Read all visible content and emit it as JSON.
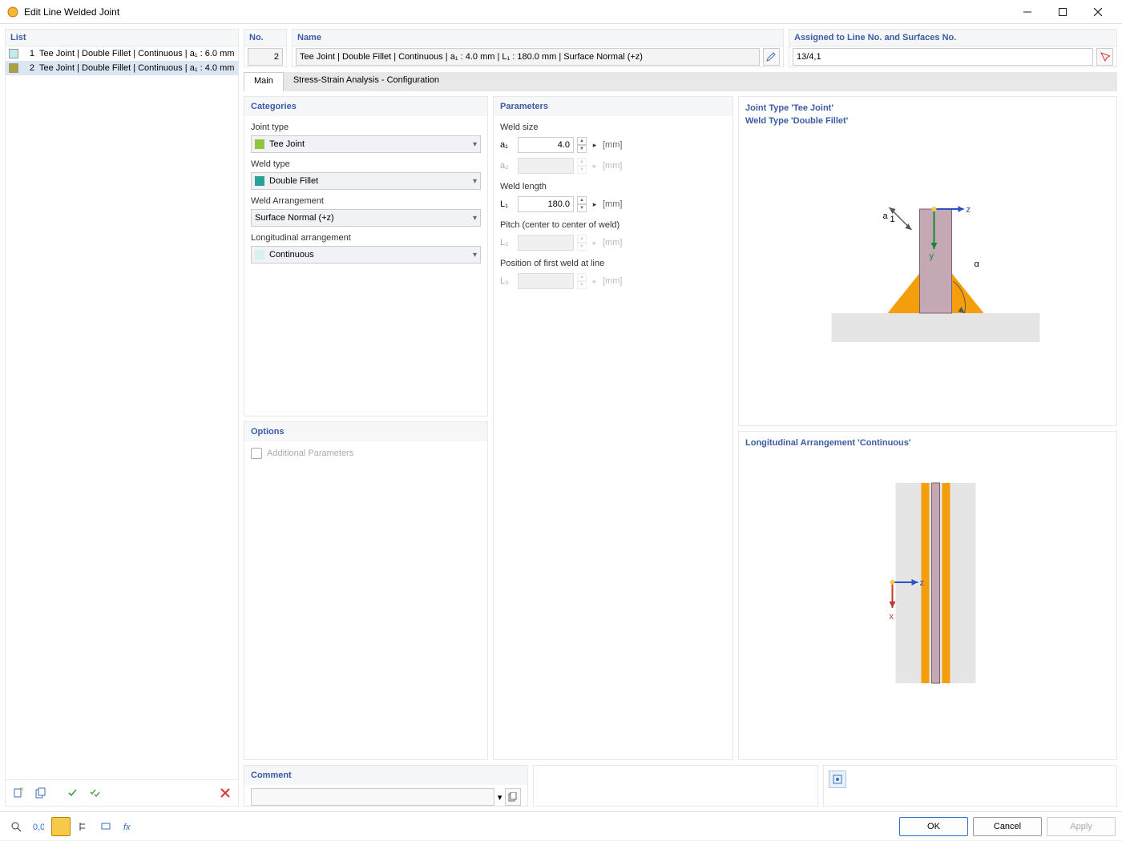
{
  "window": {
    "title": "Edit Line Welded Joint"
  },
  "list": {
    "header": "List",
    "items": [
      {
        "num": "1",
        "swatch": "#c1ecec",
        "label": "Tee Joint | Double Fillet | Continuous | a₁ : 6.0 mm"
      },
      {
        "num": "2",
        "swatch": "#a8a33a",
        "label": "Tee Joint | Double Fillet | Continuous | a₁ : 4.0 mm"
      }
    ],
    "selected": 1
  },
  "header": {
    "no_label": "No.",
    "no_value": "2",
    "name_label": "Name",
    "name_value": "Tee Joint | Double Fillet | Continuous | a₁ : 4.0 mm | L₁ : 180.0 mm | Surface Normal (+z)",
    "assign_label": "Assigned to Line No. and Surfaces No.",
    "assign_value": "13/4,1"
  },
  "tabs": {
    "main": "Main",
    "ssa": "Stress-Strain Analysis - Configuration",
    "active": 0
  },
  "categories": {
    "title": "Categories",
    "joint_type_label": "Joint type",
    "joint_type_value": "Tee Joint",
    "joint_type_swatch": "#8ec63f",
    "weld_type_label": "Weld type",
    "weld_type_value": "Double Fillet",
    "weld_type_swatch": "#2aa198",
    "arrangement_label": "Weld Arrangement",
    "arrangement_value": "Surface Normal (+z)",
    "long_label": "Longitudinal arrangement",
    "long_value": "Continuous",
    "long_swatch": "#d6f1f1"
  },
  "options": {
    "title": "Options",
    "addl": "Additional Parameters"
  },
  "parameters": {
    "title": "Parameters",
    "weld_size": "Weld size",
    "a1_label": "a₁",
    "a1_val": "4.0",
    "a2_label": "a₂",
    "a2_val": "",
    "weld_length": "Weld length",
    "L1_label": "L₁",
    "L1_val": "180.0",
    "pitch": "Pitch (center to center of weld)",
    "L2_label": "L₂",
    "L2_val": "",
    "pos": "Position of first weld at line",
    "L3_label": "L₃",
    "L3_val": "",
    "unit": "[mm]"
  },
  "preview": {
    "line1": "Joint Type 'Tee Joint'",
    "line2": "Weld Type 'Double Fillet'",
    "line3": "Longitudinal Arrangement 'Continuous'"
  },
  "comment": {
    "title": "Comment",
    "value": ""
  },
  "buttons": {
    "ok": "OK",
    "cancel": "Cancel",
    "apply": "Apply"
  }
}
